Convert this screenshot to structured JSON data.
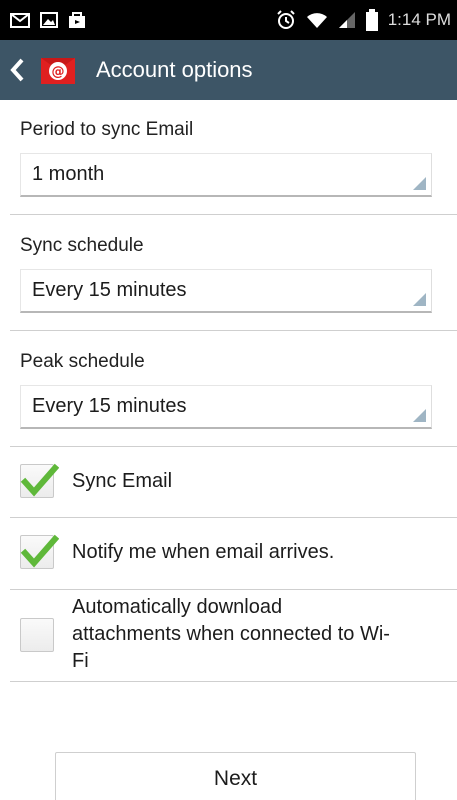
{
  "status_bar": {
    "time": "1:14 PM",
    "icons": [
      "mail-icon",
      "image-icon",
      "bag-icon",
      "alarm-icon",
      "wifi-icon",
      "signal-icon",
      "battery-icon"
    ]
  },
  "action_bar": {
    "title": "Account options",
    "color": "#3d5566",
    "app_icon": "email-app-icon"
  },
  "fields": [
    {
      "label": "Period to sync Email",
      "value": "1 month"
    },
    {
      "label": "Sync schedule",
      "value": "Every 15 minutes"
    },
    {
      "label": "Peak schedule",
      "value": "Every 15 minutes"
    }
  ],
  "checkboxes": [
    {
      "label": "Sync Email",
      "checked": true
    },
    {
      "label": "Notify me when email arrives.",
      "checked": true
    },
    {
      "label_lines": [
        "Automatically download",
        "attachments when connected to Wi-",
        "Fi"
      ],
      "checked": false
    }
  ],
  "next_button": "Next",
  "check_color": "#5fb83a"
}
